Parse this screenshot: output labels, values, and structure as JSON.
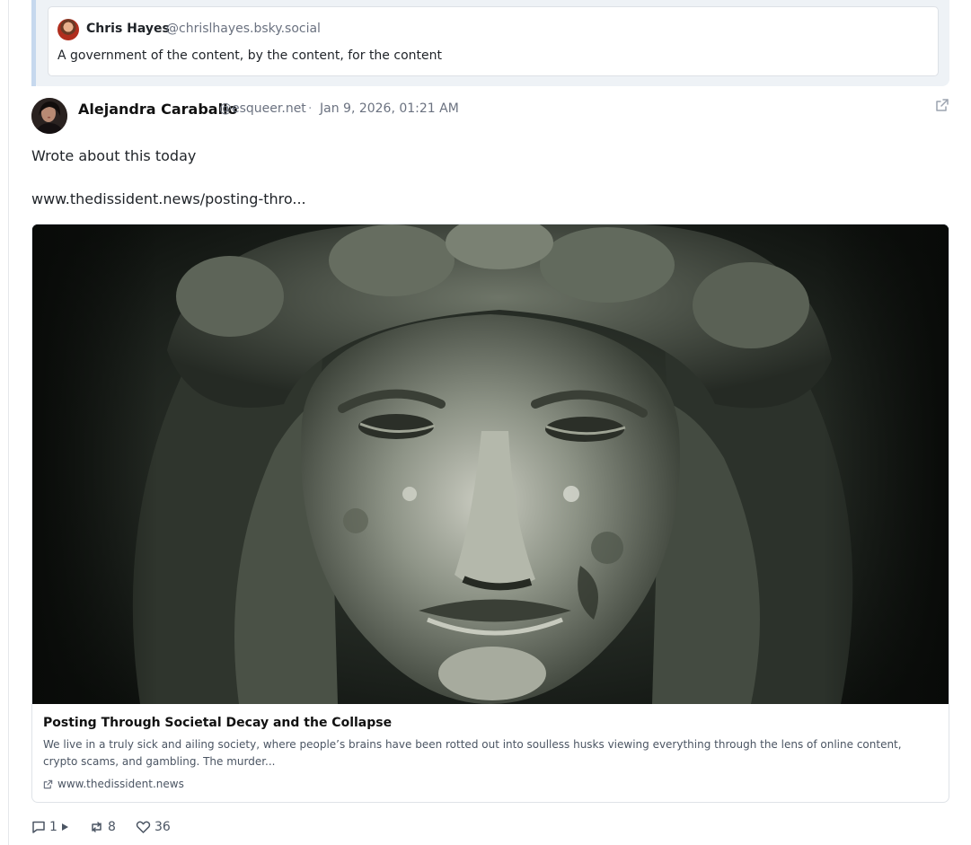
{
  "quoted_post": {
    "author_name": "Chris Hayes",
    "author_handle": "@chrislhayes.bsky.social",
    "text": "A government of the content, by the content, for the content"
  },
  "post": {
    "author_name": "Alejandra Caraballo",
    "author_handle": "@esqueer.net",
    "separator": "·",
    "timestamp": "Jan 9, 2026, 01:21 AM",
    "text": "Wrote about this today",
    "link_text": "www.thedissident.news/posting-thro..."
  },
  "link_card": {
    "title": "Posting Through Societal Decay and the Collapse",
    "description": "We live in a truly sick and ailing society, where people’s brains have been rotted out into soulless husks viewing everything through the lens of online content, crypto scams, and gambling. The murder...",
    "domain": "www.thedissident.news"
  },
  "actions": {
    "replies": "1",
    "reposts": "8",
    "likes": "36"
  }
}
